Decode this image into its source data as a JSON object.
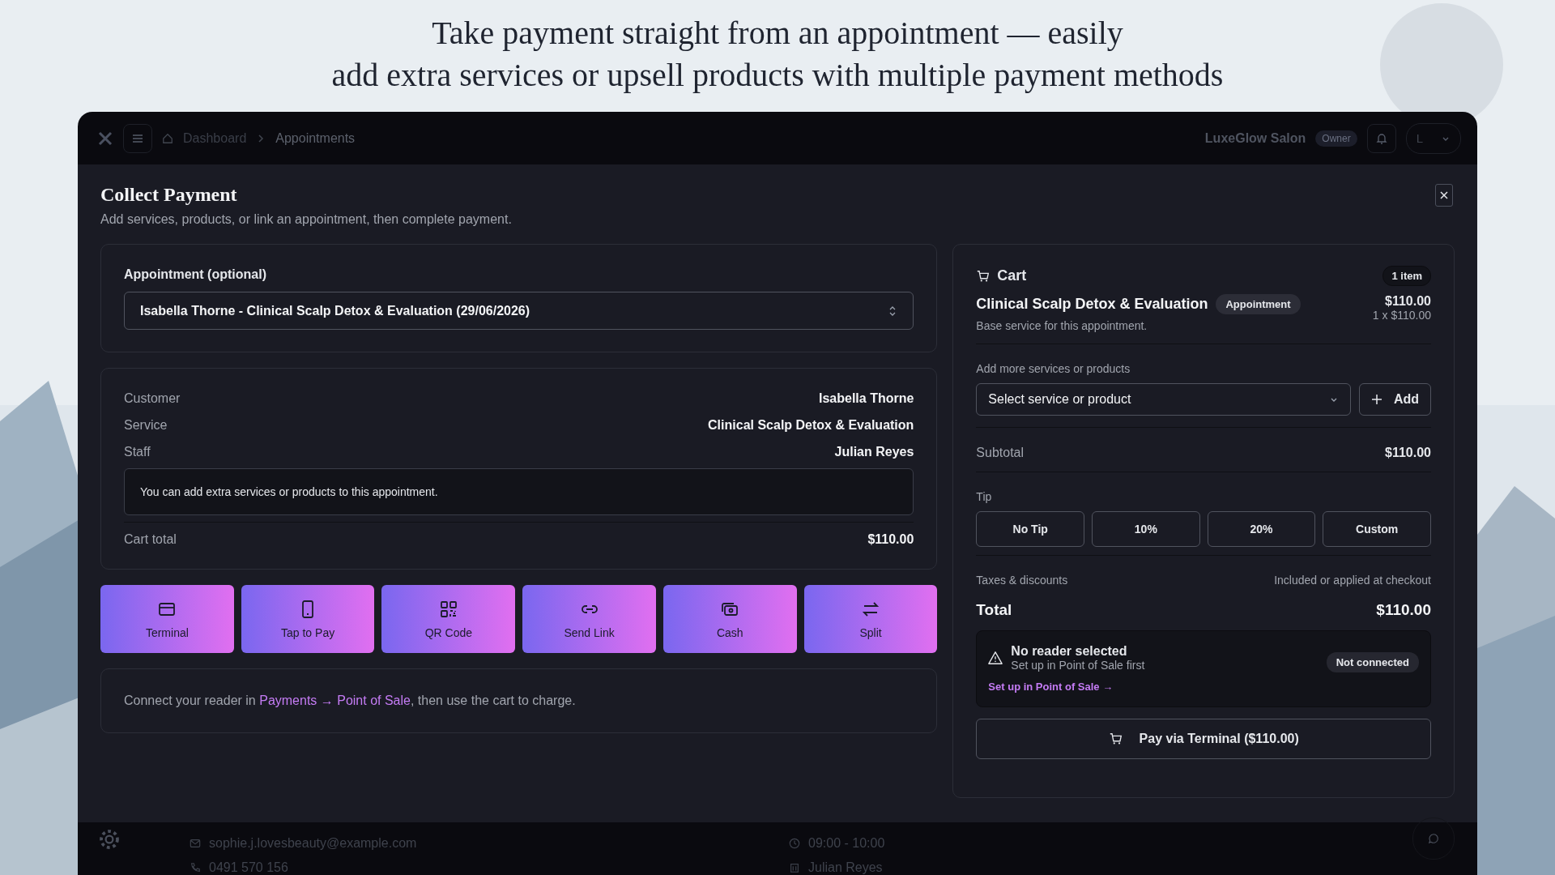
{
  "headline": [
    "Take payment straight from an appointment — easily",
    "add extra services or upsell products with multiple payment methods"
  ],
  "topbar": {
    "breadcrumbs": [
      "Dashboard",
      "Appointments"
    ],
    "salon": "LuxeGlow Salon",
    "role": "Owner",
    "user_initial": "L"
  },
  "modal": {
    "title": "Collect Payment",
    "subtitle": "Add services, products, or link an appointment, then complete payment."
  },
  "appointment": {
    "label": "Appointment (optional)",
    "value": "Isabella Thorne - Clinical Scalp Detox & Evaluation (29/06/2026)"
  },
  "details": [
    {
      "label": "Customer",
      "value": "Isabella Thorne"
    },
    {
      "label": "Service",
      "value": "Clinical Scalp Detox & Evaluation"
    },
    {
      "label": "Staff",
      "value": "Julian Reyes"
    }
  ],
  "note": "You can add extra services or products to this appointment.",
  "cart_total": {
    "label": "Cart total",
    "value": "$110.00"
  },
  "methods": [
    {
      "kind": "card",
      "label": "Terminal"
    },
    {
      "kind": "phone",
      "label": "Tap to Pay"
    },
    {
      "kind": "qr",
      "label": "QR Code"
    },
    {
      "kind": "link",
      "label": "Send Link"
    },
    {
      "kind": "cash",
      "label": "Cash"
    },
    {
      "kind": "split",
      "label": "Split"
    }
  ],
  "hint": {
    "before": "Connect your reader in ",
    "link": "Payments → Point of Sale",
    "after": ", then use the cart to charge."
  },
  "cart": {
    "title": "Cart",
    "count": "1 item",
    "item": {
      "name": "Clinical Scalp Detox & Evaluation",
      "tag": "Appointment",
      "price": "$110.00",
      "qty": "1 x $110.00",
      "note": "Base service for this appointment."
    },
    "add_label": "Add more services or products",
    "select_placeholder": "Select service or product",
    "add_button": "Add",
    "subtotal_label": "Subtotal",
    "subtotal": "$110.00",
    "tip_label": "Tip",
    "tips": [
      "No Tip",
      "10%",
      "20%",
      "Custom"
    ],
    "taxes_label": "Taxes & discounts",
    "taxes_value": "Included or applied at checkout",
    "total_label": "Total",
    "total": "$110.00",
    "reader": {
      "title": "No reader selected",
      "subtitle": "Set up in Point of Sale first",
      "link": "Set up in Point of Sale →",
      "status": "Not connected"
    },
    "pay_button": "Pay via Terminal ($110.00)"
  },
  "background_page": {
    "email": "sophie.j.lovesbeauty@example.com",
    "phone": "0491 570 156",
    "time": "09:00 - 10:00",
    "staff": "Julian Reyes"
  }
}
